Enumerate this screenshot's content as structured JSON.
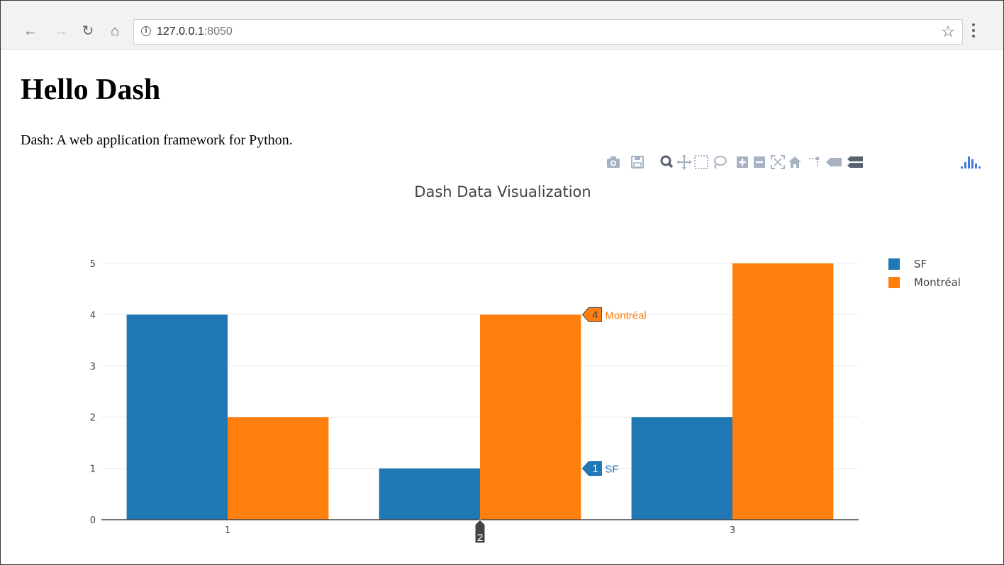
{
  "browser": {
    "url_host": "127.0.0.1",
    "url_port": ":8050",
    "back_icon": "back-arrow-icon",
    "forward_icon": "forward-arrow-icon",
    "reload_icon": "reload-icon",
    "home_icon": "home-icon",
    "bookmark_icon": "star-icon",
    "menu_icon": "kebab-menu-icon"
  },
  "page": {
    "title": "Hello Dash",
    "subtitle": "Dash: A web application framework for Python."
  },
  "modebar": {
    "icons": [
      "camera-icon",
      "save-icon",
      "zoom-icon",
      "pan-icon",
      "box-select-icon",
      "lasso-icon",
      "zoom-in-icon",
      "zoom-out-icon",
      "autoscale-icon",
      "reset-axes-icon",
      "spike-lines-icon",
      "hover-closest-icon",
      "hover-compare-icon",
      "plotly-logo-icon"
    ]
  },
  "colors": {
    "sf": "#1f77b4",
    "montreal": "#ff7f0e",
    "grid": "#eeeeee",
    "axis_text": "#444444",
    "axis_line": "#444444",
    "modebar_icon": "#a6b2c4",
    "plotly_logo": "#447adb"
  },
  "chart_data": {
    "type": "bar",
    "title": "Dash Data Visualization",
    "categories": [
      1,
      2,
      3
    ],
    "series": [
      {
        "name": "SF",
        "values": [
          4,
          1,
          2
        ]
      },
      {
        "name": "Montréal",
        "values": [
          2,
          4,
          5
        ]
      }
    ],
    "ylim": [
      0,
      5
    ],
    "yticks": [
      0,
      1,
      2,
      3,
      4,
      5
    ],
    "grid": true,
    "legend_position": "top-right",
    "hover": {
      "x": 2,
      "x_label": "2",
      "labels": [
        {
          "series": "SF",
          "value": "1",
          "text": "SF"
        },
        {
          "series": "Montréal",
          "value": "4",
          "text": "Montréal"
        }
      ]
    }
  }
}
